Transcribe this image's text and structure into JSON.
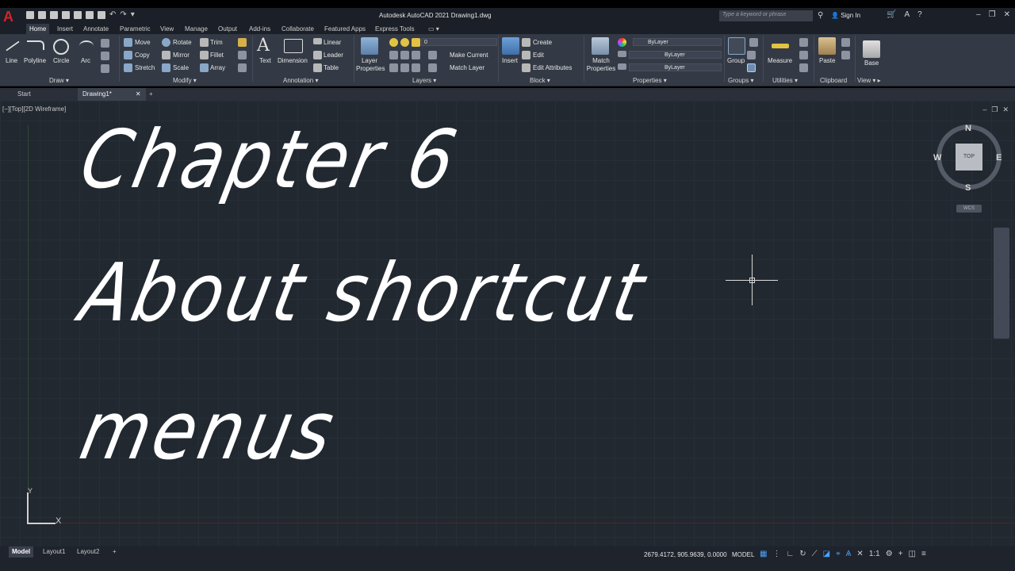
{
  "titlebar": {
    "app_title": "Autodesk AutoCAD 2021   Drawing1.dwg",
    "search_placeholder": "Type a keyword or phrase",
    "signin": "Sign In"
  },
  "ribbon_tabs": [
    "Home",
    "Insert",
    "Annotate",
    "Parametric",
    "View",
    "Manage",
    "Output",
    "Add-ins",
    "Collaborate",
    "Featured Apps",
    "Express Tools"
  ],
  "ribbon": {
    "draw": {
      "label": "Draw",
      "tools": [
        "Line",
        "Polyline",
        "Circle",
        "Arc"
      ]
    },
    "modify": {
      "label": "Modify",
      "tools": [
        "Move",
        "Rotate",
        "Trim",
        "Copy",
        "Mirror",
        "Fillet",
        "Stretch",
        "Scale",
        "Array"
      ]
    },
    "annotation": {
      "label": "Annotation",
      "tools": [
        "Text",
        "Dimension",
        "Linear",
        "Leader",
        "Table"
      ]
    },
    "layers": {
      "label": "Layers",
      "layer_properties": "Layer Properties",
      "current_layer": "0",
      "make_current": "Make Current",
      "match_layer": "Match Layer"
    },
    "block": {
      "label": "Block",
      "insert": "Insert",
      "create": "Create",
      "edit": "Edit",
      "edit_attributes": "Edit Attributes"
    },
    "properties": {
      "label": "Properties",
      "match": "Match Properties",
      "color": "ByLayer",
      "linetype": "ByLayer",
      "lineweight": "ByLayer"
    },
    "groups": {
      "label": "Groups",
      "group": "Group"
    },
    "utilities": {
      "label": "Utilities",
      "measure": "Measure"
    },
    "clipboard": {
      "label": "Clipboard",
      "paste": "Paste"
    },
    "view": {
      "label": "View",
      "base": "Base"
    }
  },
  "doc_tabs": [
    "Start",
    "Drawing1*"
  ],
  "viewport_label": "[−][Top][2D Wireframe]",
  "drawing_text": [
    "Chapter 6",
    "About shortcut",
    "menus"
  ],
  "viewcube": {
    "face": "TOP",
    "north": "N",
    "south": "S",
    "east": "E",
    "west": "W",
    "wcs": "WCS"
  },
  "ucs": {
    "x": "X",
    "y": "Y"
  },
  "status": {
    "layout_tabs": [
      "Model",
      "Layout1",
      "Layout2"
    ],
    "coordinates": "2679.4172, 905.9639, 0.0000",
    "space": "MODEL"
  },
  "colors": {
    "canvas": "#212830",
    "ribbon": "#333a45",
    "accent_red": "#d3242b"
  }
}
